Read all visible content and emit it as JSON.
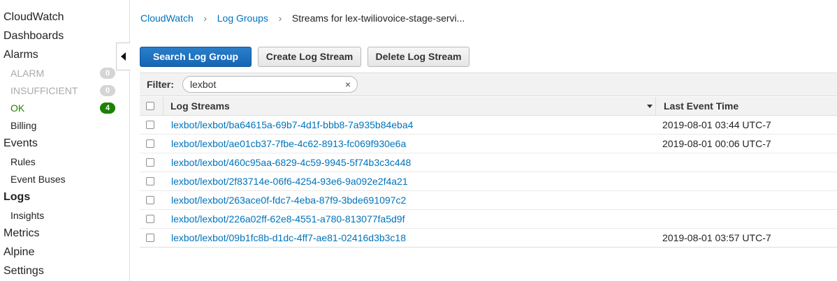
{
  "sidebar": {
    "items": [
      {
        "label": "CloudWatch",
        "level": "top"
      },
      {
        "label": "Dashboards",
        "level": "top"
      },
      {
        "label": "Alarms",
        "level": "top"
      },
      {
        "label": "ALARM",
        "level": "sub",
        "badge": "0",
        "state": "muted"
      },
      {
        "label": "INSUFFICIENT",
        "level": "sub",
        "badge": "0",
        "state": "muted"
      },
      {
        "label": "OK",
        "level": "sub",
        "badge": "4",
        "state": "ok"
      },
      {
        "label": "Billing",
        "level": "sub"
      },
      {
        "label": "Events",
        "level": "top"
      },
      {
        "label": "Rules",
        "level": "sub"
      },
      {
        "label": "Event Buses",
        "level": "sub"
      },
      {
        "label": "Logs",
        "level": "top",
        "active": true
      },
      {
        "label": "Insights",
        "level": "sub"
      },
      {
        "label": "Metrics",
        "level": "top"
      },
      {
        "label": "Alpine",
        "level": "top"
      },
      {
        "label": "Settings",
        "level": "top"
      }
    ]
  },
  "breadcrumb": {
    "items": [
      "CloudWatch",
      "Log Groups"
    ],
    "current": "Streams for lex-twiliovoice-stage-servi..."
  },
  "toolbar": {
    "search_label": "Search Log Group",
    "create_label": "Create Log Stream",
    "delete_label": "Delete Log Stream"
  },
  "filter": {
    "label": "Filter:",
    "value": "lexbot",
    "clear_symbol": "×"
  },
  "table": {
    "columns": [
      "Log Streams",
      "Last Event Time"
    ],
    "rows": [
      {
        "stream": "lexbot/lexbot/ba64615a-69b7-4d1f-bbb8-7a935b84eba4",
        "time": "2019-08-01 03:44 UTC-7"
      },
      {
        "stream": "lexbot/lexbot/ae01cb37-7fbe-4c62-8913-fc069f930e6a",
        "time": "2019-08-01 00:06 UTC-7"
      },
      {
        "stream": "lexbot/lexbot/460c95aa-6829-4c59-9945-5f74b3c3c448",
        "time": ""
      },
      {
        "stream": "lexbot/lexbot/2f83714e-06f6-4254-93e6-9a092e2f4a21",
        "time": ""
      },
      {
        "stream": "lexbot/lexbot/263ace0f-fdc7-4eba-87f9-3bde691097c2",
        "time": ""
      },
      {
        "stream": "lexbot/lexbot/226a02ff-62e8-4551-a780-813077fa5d9f",
        "time": ""
      },
      {
        "stream": "lexbot/lexbot/09b1fc8b-d1dc-4ff7-ae81-02416d3b3c18",
        "time": "2019-08-01 03:57 UTC-7"
      }
    ]
  },
  "colors": {
    "link": "#0073bb",
    "primary_button": "#1f72c0",
    "ok_green": "#1d8102"
  }
}
